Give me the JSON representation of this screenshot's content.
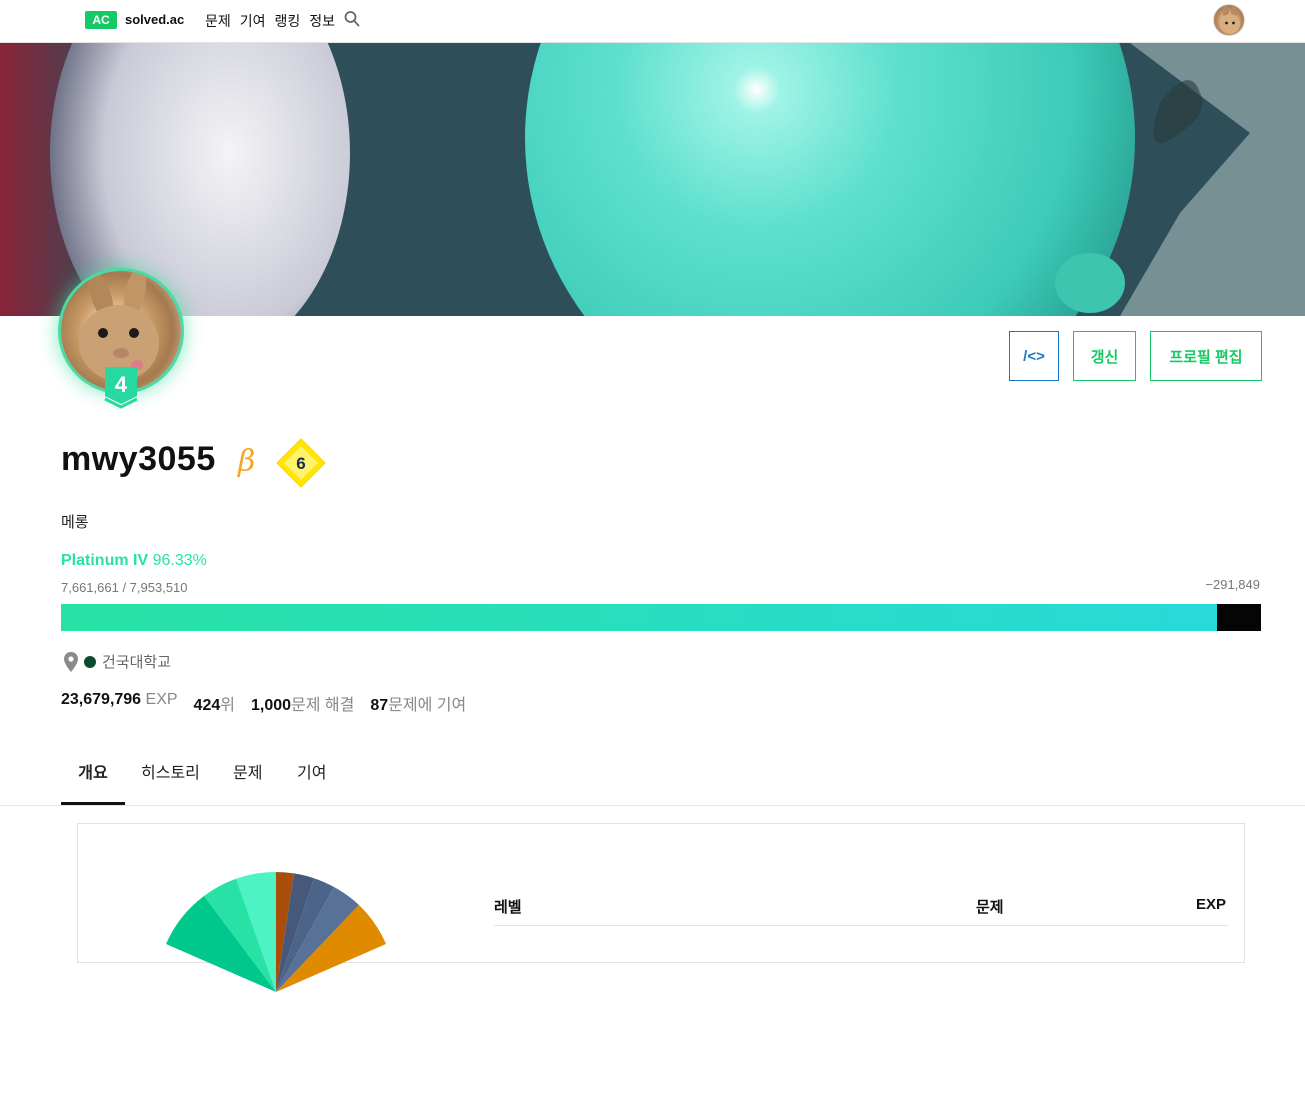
{
  "nav": {
    "logo_badge": "AC",
    "logo_text": "solved.ac",
    "menu": [
      "문제",
      "기여",
      "랭킹",
      "정보"
    ],
    "search_icon": "search-icon",
    "avatar_icon": "user-avatar"
  },
  "profile": {
    "tier_badge_number": "4",
    "username": "mwy3055",
    "beta_mark": "β",
    "class_number": "6",
    "bio": "메롱",
    "tier_name": "Platinum IV",
    "tier_percent": "96.33%",
    "rating_text": "7,661,661 / 7,953,510",
    "rating_diff": "−291,849",
    "progress_fraction": 0.9633,
    "school": "건국대학교",
    "stats": {
      "exp_value": "23,679,796",
      "exp_unit": "EXP",
      "rank_value": "424",
      "rank_unit": "위",
      "solved_value": "1,000",
      "solved_unit": "문제 해결",
      "contrib_value": "87",
      "contrib_unit": "문제에 기여"
    }
  },
  "buttons": {
    "code_label": "/<>",
    "refresh_label": "갱신",
    "edit_label": "프로필 편집"
  },
  "tabs": [
    "개요",
    "히스토리",
    "문제",
    "기여"
  ],
  "active_tab": "개요",
  "overview": {
    "columns": [
      "레벨",
      "문제",
      "EXP"
    ]
  },
  "colors": {
    "brand_green": "#17c964",
    "platinum": "#27e2a4",
    "link_blue": "#1677c9",
    "beta": "#f5a623"
  }
}
